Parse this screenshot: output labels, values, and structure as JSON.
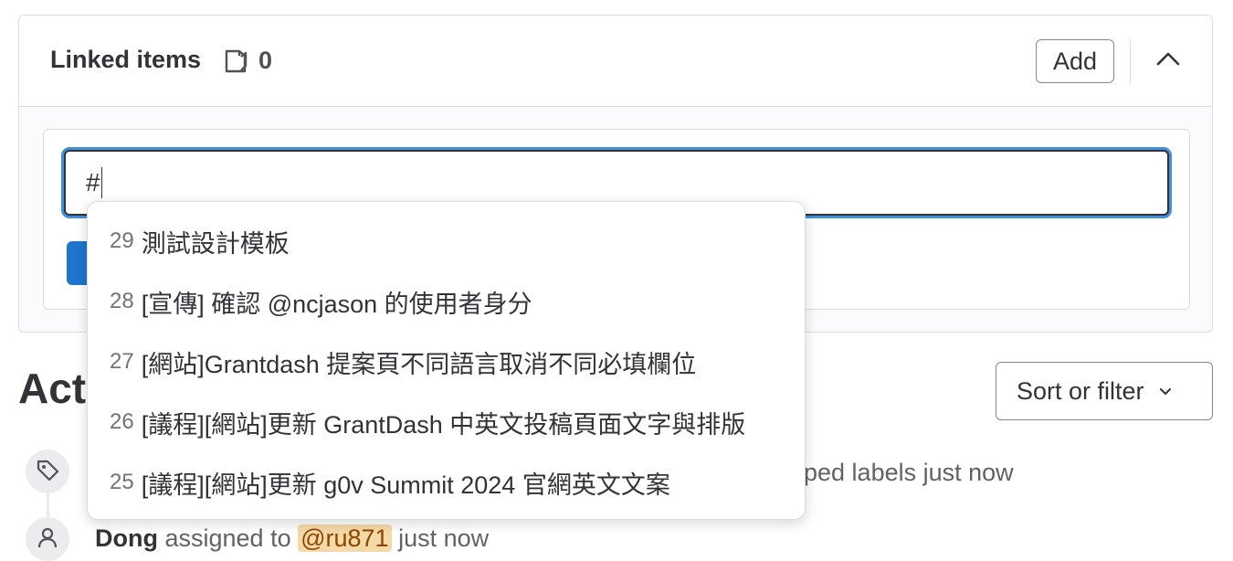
{
  "linked_items": {
    "title": "Linked items",
    "count": "0",
    "add_label": "Add",
    "input_value": "#"
  },
  "suggestions": [
    {
      "num": "29",
      "title": "測試設計模板"
    },
    {
      "num": "28",
      "title": "[宣傳] 確認 @ncjason 的使用者身分"
    },
    {
      "num": "27",
      "title": "[網站]Grantdash 提案頁不同語言取消不同必填欄位"
    },
    {
      "num": "26",
      "title": "[議程][網站]更新 GrantDash 中英文投稿頁面文字與排版"
    },
    {
      "num": "25",
      "title": "[議程][網站]更新 g0v Summit 2024 官網英文文案"
    }
  ],
  "activity": {
    "title_visible": "Act",
    "sort_label": "Sort or filter",
    "event1_text": "ped labels just now",
    "event2_user": "Dong",
    "event2_action": " assigned to ",
    "event2_mention": "@ru871",
    "event2_time": " just now"
  },
  "colors": {
    "accent": "#1f75cb",
    "focus_ring": "#428fdc",
    "border": "#dcdcde",
    "mention_bg": "#f5d9a8"
  },
  "icons": {
    "count": "issue-type-icon",
    "collapse": "chevron-up-icon",
    "sort": "chevron-down-icon",
    "event1": "label-icon",
    "event2": "user-icon"
  }
}
